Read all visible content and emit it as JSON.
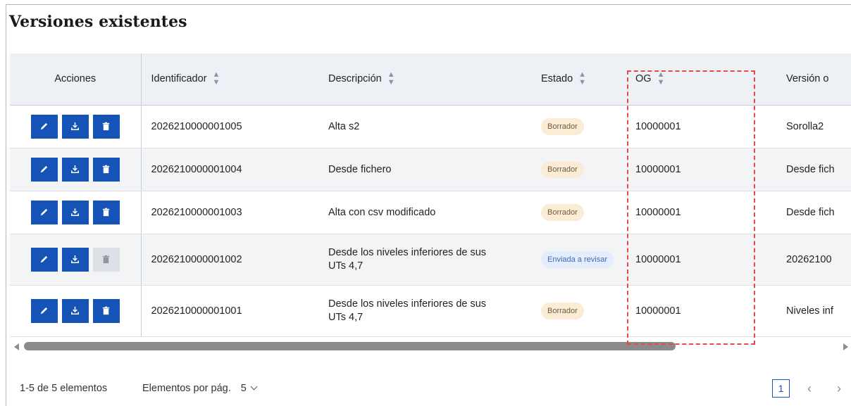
{
  "title": "Versiones existentes",
  "columns": {
    "actions": "Acciones",
    "identificador": "Identificador",
    "descripcion": "Descripción",
    "estado": "Estado",
    "og": "OG",
    "version": "Versión o"
  },
  "rows": [
    {
      "identificador": "2026210000001005",
      "descripcion": "Alta s2",
      "estado": "Borrador",
      "og": "10000001",
      "version": "Sorolla2",
      "delete_enabled": true
    },
    {
      "identificador": "2026210000001004",
      "descripcion": "Desde fichero",
      "estado": "Borrador",
      "og": "10000001",
      "version": "Desde fich",
      "delete_enabled": true
    },
    {
      "identificador": "2026210000001003",
      "descripcion": "Alta con csv modificado",
      "estado": "Borrador",
      "og": "10000001",
      "version": "Desde fich",
      "delete_enabled": true
    },
    {
      "identificador": "2026210000001002",
      "descripcion_l1": "Desde los niveles inferiores de sus",
      "descripcion_l2": "UTs 4,7",
      "estado": "Enviada a revisar",
      "og": "10000001",
      "version": "20262100",
      "delete_enabled": false
    },
    {
      "identificador": "2026210000001001",
      "descripcion_l1": "Desde los niveles inferiores de sus",
      "descripcion_l2": "UTs 4,7",
      "estado": "Borrador",
      "og": "10000001",
      "version": "Niveles inf",
      "delete_enabled": true
    }
  ],
  "footer": {
    "range": "1-5 de 5 elementos",
    "per_page_label": "Elementos por pág.",
    "per_page_value": "5",
    "current_page": "1",
    "prev": "‹",
    "next": "›"
  },
  "icons": {
    "edit": "pencil-icon",
    "download": "download-icon",
    "delete": "trash-icon",
    "sort": "sort-icon"
  },
  "colors": {
    "primary": "#1553b7",
    "badge_draft_bg": "#fbecd5",
    "badge_review_bg": "#e3edfb",
    "highlight": "#e34b4b"
  }
}
